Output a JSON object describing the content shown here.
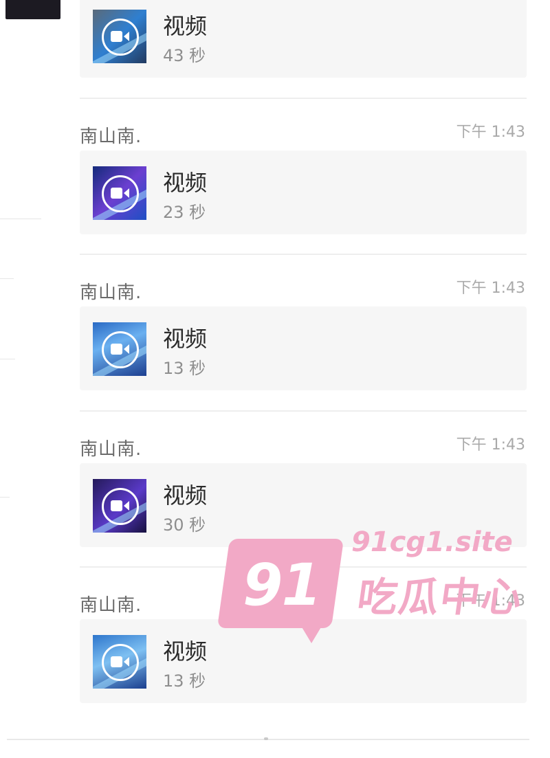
{
  "messages": [
    {
      "sender": "",
      "time": "",
      "label": "视频",
      "duration": "43 秒"
    },
    {
      "sender": "南山南.",
      "time": "下午 1:43",
      "label": "视频",
      "duration": "23 秒"
    },
    {
      "sender": "南山南.",
      "time": "下午 1:43",
      "label": "视频",
      "duration": "13 秒"
    },
    {
      "sender": "南山南.",
      "time": "下午 1:43",
      "label": "视频",
      "duration": "30 秒"
    },
    {
      "sender": "南山南.",
      "time": "下午 1:43",
      "label": "视频",
      "duration": "13 秒"
    }
  ],
  "watermark": {
    "number": "91",
    "site": "91cg1.site",
    "title": "吃瓜中心",
    "color": "#f2a9c6"
  },
  "icons": {
    "video": "video-camera-icon"
  }
}
